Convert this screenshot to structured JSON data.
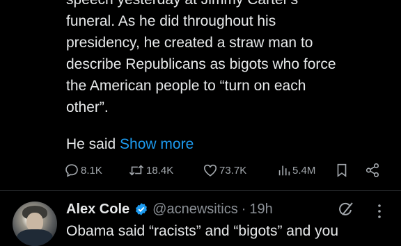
{
  "tweet": {
    "lines": [
      "speech yesterday at Jimmy Carter's",
      "funeral. As he did throughout his",
      "presidency, he created a straw man to",
      "describe Republicans as bigots who force",
      "the American people to “turn on each",
      "other”."
    ],
    "more_prefix": "He said",
    "show_more": "Show more"
  },
  "actions": {
    "replies": "8.1K",
    "reposts": "18.4K",
    "likes": "73.7K",
    "views": "5.4M"
  },
  "reply": {
    "author": "Alex Cole",
    "handle": "@acnewsitics",
    "separator": "·",
    "time": "19h",
    "text": "Obama said “racists” and “bigots” and you"
  },
  "colors": {
    "background": "#000000",
    "text": "#e7e9ea",
    "secondary": "#8b9096",
    "link": "#1d9bf0",
    "verified": "#1d9bf0"
  }
}
